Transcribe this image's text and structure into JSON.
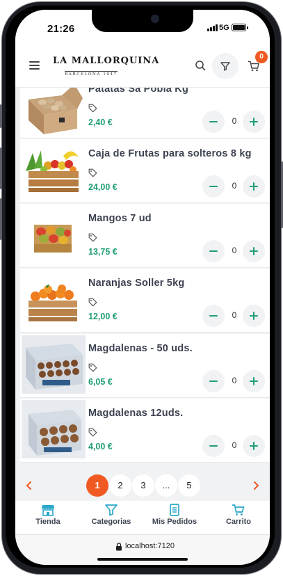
{
  "status_bar": {
    "time": "21:26",
    "network": "5G"
  },
  "header": {
    "brand_name": "LA MALLORQUINA",
    "brand_subtitle": "BARCELONA 1947",
    "cart_count": "0"
  },
  "products": [
    {
      "name": "Patatas Sa Pobla Kg",
      "price": "2,40 €",
      "quantity": "0"
    },
    {
      "name": "Caja de Frutas para solteros 8 kg",
      "price": "24,00 €",
      "quantity": "0"
    },
    {
      "name": "Mangos 7 ud",
      "price": "13,75 €",
      "quantity": "0"
    },
    {
      "name": "Naranjas Soller 5kg",
      "price": "12,00 €",
      "quantity": "0"
    },
    {
      "name": "Magdalenas - 50 uds.",
      "price": "6,05 €",
      "quantity": "0"
    },
    {
      "name": "Magdalenas 12uds.",
      "price": "4,00 €",
      "quantity": "0"
    }
  ],
  "pagination": {
    "pages": [
      "1",
      "2",
      "3",
      "...",
      "5"
    ],
    "current": "1"
  },
  "bottom_nav": [
    {
      "label": "Tienda"
    },
    {
      "label": "Categorias"
    },
    {
      "label": "Mis Pedidos"
    },
    {
      "label": "Carrito"
    }
  ],
  "url_bar": {
    "url": "localhost:7120"
  },
  "colors": {
    "accent": "#f05a22",
    "price": "#1f9e74",
    "nav_icon": "#2aa7c9"
  }
}
